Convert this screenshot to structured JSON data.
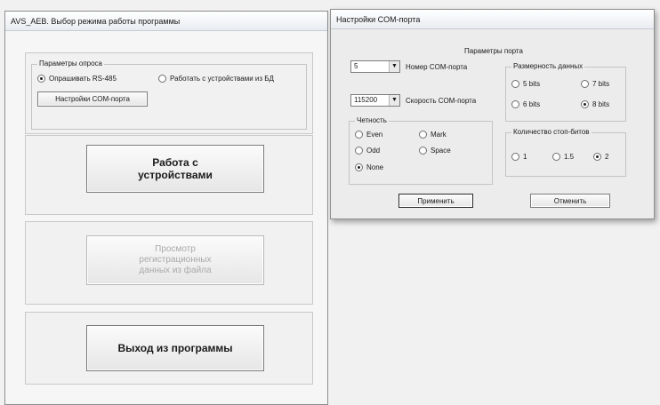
{
  "main_window": {
    "title": "AVS_AEB. Выбор режима работы программы",
    "poll_group": {
      "caption": "Параметры опроса",
      "radio_rs485": "Опрашивать RS-485",
      "radio_db": "Работать с устройствами из БД",
      "com_settings_button": "Настройки COM-порта"
    },
    "work_button": "Работа с\nустройствами",
    "view_button": "Просмотр\nрегистрационных\nданных из файла",
    "exit_button": "Выход из программы"
  },
  "com_dialog": {
    "title": "Настройки COM-порта",
    "port_params_caption": "Параметры порта",
    "port": {
      "value": "5",
      "label": "Номер COM-порта"
    },
    "speed": {
      "value": "115200",
      "label": "Скорость COM-порта"
    },
    "parity": {
      "caption": "Четность",
      "options": [
        "Even",
        "Mark",
        "Odd",
        "Space",
        "None"
      ],
      "selected": "None"
    },
    "data_bits": {
      "caption": "Размерность данных",
      "options": [
        "5 bits",
        "7 bits",
        "6 bits",
        "8 bits"
      ],
      "selected": "8 bits"
    },
    "stop_bits": {
      "caption": "Количество стоп-битов",
      "options": [
        "1",
        "1.5",
        "2"
      ],
      "selected": "2"
    },
    "apply_button": "Применить",
    "cancel_button": "Отменить"
  }
}
